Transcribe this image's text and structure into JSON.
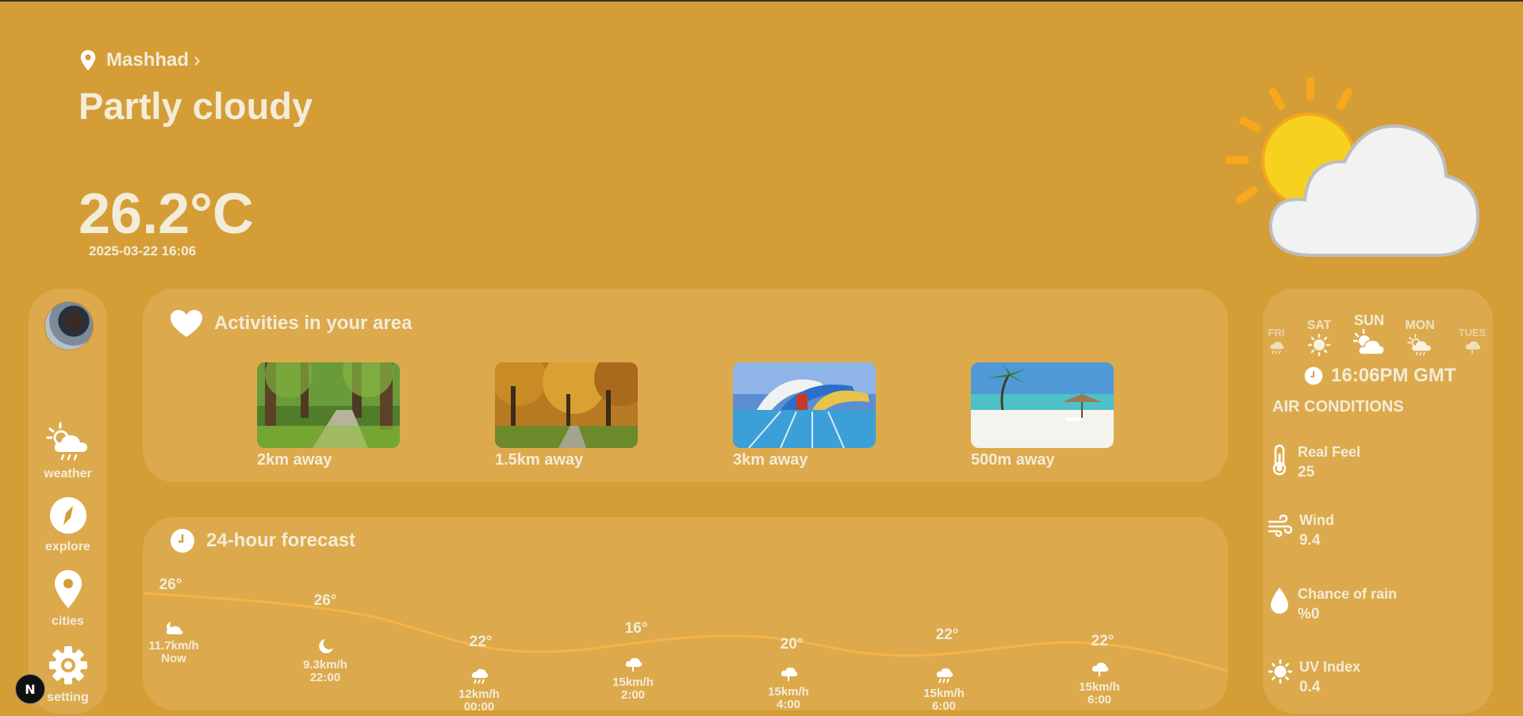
{
  "header": {
    "city": "Mashhad",
    "condition": "Partly cloudy",
    "temperature": "26.2°C",
    "datetime": "2025-03-22 16:06"
  },
  "sidebar": {
    "items": [
      {
        "label": "weather",
        "icon": "cloud-sun-rain-icon"
      },
      {
        "label": "explore",
        "icon": "compass-icon"
      },
      {
        "label": "cities",
        "icon": "map-pin-icon"
      },
      {
        "label": "setting",
        "icon": "gear-icon"
      }
    ]
  },
  "activities": {
    "title": "Activities in your area",
    "items": [
      {
        "distance": "2km away",
        "scene": "park-path"
      },
      {
        "distance": "1.5km away",
        "scene": "autumn-park"
      },
      {
        "distance": "3km away",
        "scene": "water-park"
      },
      {
        "distance": "500m away",
        "scene": "beach"
      }
    ]
  },
  "forecast": {
    "title": "24-hour forecast",
    "hours": [
      {
        "temp": "26°",
        "wind": "11.7km/h",
        "time": "Now",
        "icon": "cloud-moon-icon"
      },
      {
        "temp": "26°",
        "wind": "9.3km/h",
        "time": "22:00",
        "icon": "moon-icon"
      },
      {
        "temp": "22°",
        "wind": "12km/h",
        "time": "00:00",
        "icon": "cloud-rain-icon"
      },
      {
        "temp": "16°",
        "wind": "15km/h",
        "time": "2:00",
        "icon": "cloud-drizzle-icon"
      },
      {
        "temp": "20°",
        "wind": "15km/h",
        "time": "4:00",
        "icon": "cloud-drizzle-icon"
      },
      {
        "temp": "22°",
        "wind": "15km/h",
        "time": "6:00",
        "icon": "cloud-rain-icon"
      },
      {
        "temp": "22°",
        "wind": "15km/h",
        "time": "6:00",
        "icon": "cloud-drizzle-icon"
      }
    ]
  },
  "week": {
    "days": [
      {
        "name": "FRI",
        "icon": "cloud-rain-icon"
      },
      {
        "name": "SAT",
        "icon": "sun-icon"
      },
      {
        "name": "SUN",
        "icon": "cloud-sun-icon"
      },
      {
        "name": "MON",
        "icon": "cloud-sun-rain-icon"
      },
      {
        "name": "TUES",
        "icon": "cloud-drizzle-icon"
      }
    ],
    "selected": "SUN",
    "time": "16:06PM GMT"
  },
  "air": {
    "title": "AIR CONDITIONS",
    "items": [
      {
        "label": "Real Feel",
        "value": "25",
        "icon": "thermometer-icon"
      },
      {
        "label": "Wind",
        "value": "9.4",
        "icon": "wind-icon"
      },
      {
        "label": "Chance of rain",
        "value": "%0",
        "icon": "droplet-icon"
      },
      {
        "label": "UV Index",
        "value": "0.4",
        "icon": "sun-icon"
      }
    ]
  },
  "badge": "N",
  "colors": {
    "background": "#d59d36",
    "panel": "#dcaa4c",
    "curve": "#f3b24a",
    "text": "#f3ecd9"
  }
}
